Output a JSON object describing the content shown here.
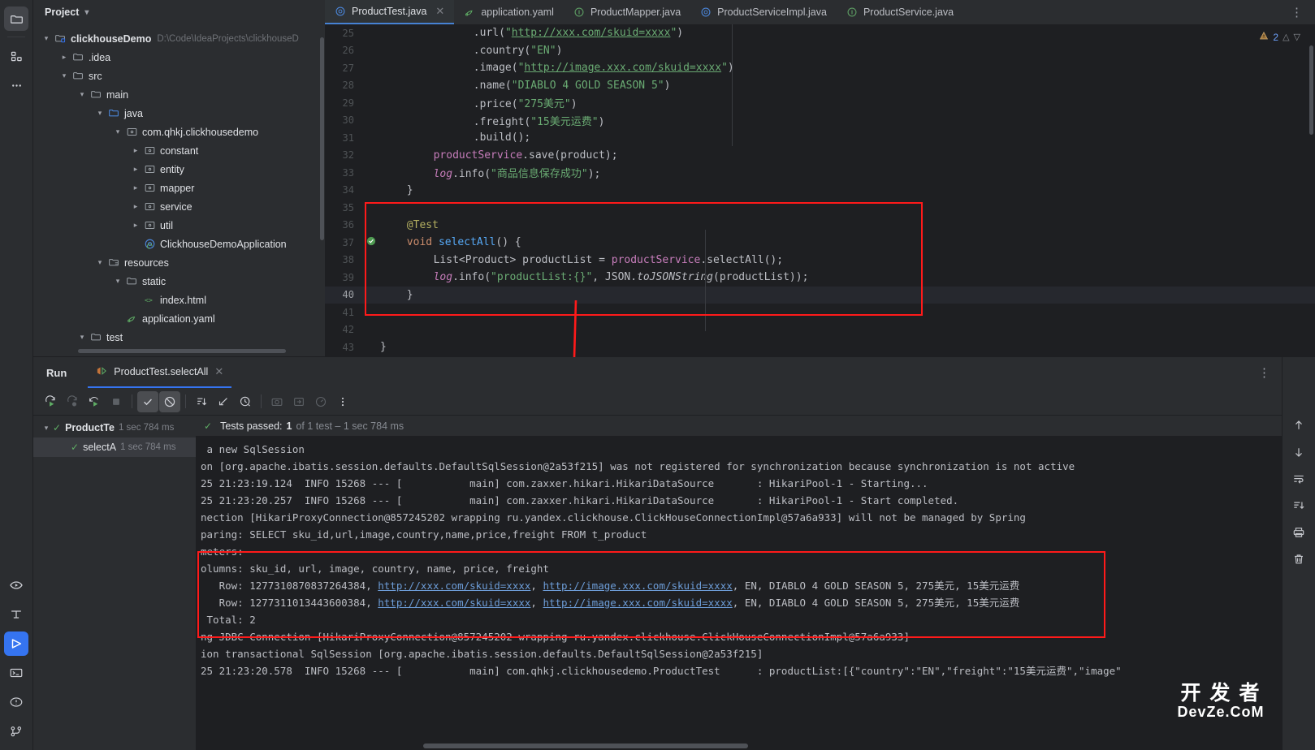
{
  "activity_bar": {
    "items": [
      {
        "name": "project-icon",
        "glyph": "folder"
      },
      {
        "name": "structure-icon",
        "glyph": "blocks"
      },
      {
        "name": "more-tools-icon",
        "glyph": "dots"
      }
    ],
    "bottom_items": [
      {
        "name": "run-anything-icon",
        "glyph": "eye-play"
      },
      {
        "name": "profiler-icon",
        "glyph": "t-shape"
      },
      {
        "name": "run-icon",
        "glyph": "play"
      },
      {
        "name": "terminal-icon",
        "glyph": "terminal"
      },
      {
        "name": "problems-icon",
        "glyph": "warning-circle"
      },
      {
        "name": "version-control-icon",
        "glyph": "branch"
      }
    ]
  },
  "project_panel": {
    "title": "Project",
    "tree": [
      {
        "depth": 0,
        "twisty": "down",
        "icon": "module",
        "label": "clickhouseDemo",
        "bold": true,
        "path": "D:\\Code\\IdeaProjects\\clickhouseD"
      },
      {
        "depth": 1,
        "twisty": "right",
        "icon": "folder",
        "label": ".idea"
      },
      {
        "depth": 1,
        "twisty": "down",
        "icon": "folder",
        "label": "src"
      },
      {
        "depth": 2,
        "twisty": "down",
        "icon": "folder",
        "label": "main"
      },
      {
        "depth": 3,
        "twisty": "down",
        "icon": "source",
        "label": "java"
      },
      {
        "depth": 4,
        "twisty": "down",
        "icon": "package",
        "label": "com.qhkj.clickhousedemo"
      },
      {
        "depth": 5,
        "twisty": "right",
        "icon": "package",
        "label": "constant"
      },
      {
        "depth": 5,
        "twisty": "right",
        "icon": "package",
        "label": "entity"
      },
      {
        "depth": 5,
        "twisty": "right",
        "icon": "package",
        "label": "mapper"
      },
      {
        "depth": 5,
        "twisty": "right",
        "icon": "package",
        "label": "service"
      },
      {
        "depth": 5,
        "twisty": "right",
        "icon": "package",
        "label": "util"
      },
      {
        "depth": 5,
        "twisty": "none",
        "icon": "springclass",
        "label": "ClickhouseDemoApplication"
      },
      {
        "depth": 3,
        "twisty": "down",
        "icon": "resources",
        "label": "resources"
      },
      {
        "depth": 4,
        "twisty": "down",
        "icon": "folder",
        "label": "static"
      },
      {
        "depth": 5,
        "twisty": "none",
        "icon": "html",
        "label": "index.html"
      },
      {
        "depth": 4,
        "twisty": "none",
        "icon": "yaml",
        "label": "application.yaml"
      },
      {
        "depth": 2,
        "twisty": "down",
        "icon": "folder",
        "label": "test"
      }
    ]
  },
  "editor": {
    "tabs": [
      {
        "label": "ProductTest.java",
        "icon": "class-icon",
        "active": true,
        "closable": true
      },
      {
        "label": "application.yaml",
        "icon": "yaml-icon",
        "active": false,
        "closable": false
      },
      {
        "label": "ProductMapper.java",
        "icon": "interface-icon",
        "active": false,
        "closable": false
      },
      {
        "label": "ProductServiceImpl.java",
        "icon": "class-icon",
        "active": false,
        "closable": false
      },
      {
        "label": "ProductService.java",
        "icon": "interface-icon",
        "active": false,
        "closable": false
      }
    ],
    "warnings": {
      "count": "2",
      "icon": "warning-icon"
    },
    "lines": [
      {
        "num": "25",
        "indent": 14,
        "runs": [
          {
            "t": ".url(",
            "c": "pln"
          },
          {
            "t": "\"",
            "c": "str"
          },
          {
            "t": "http://xxx.com/skuid=xxxx",
            "c": "link-str"
          },
          {
            "t": "\"",
            "c": "str"
          },
          {
            "t": ")",
            "c": "pln"
          }
        ]
      },
      {
        "num": "26",
        "indent": 14,
        "runs": [
          {
            "t": ".country(",
            "c": "pln"
          },
          {
            "t": "\"EN\"",
            "c": "str"
          },
          {
            "t": ")",
            "c": "pln"
          }
        ]
      },
      {
        "num": "27",
        "indent": 14,
        "runs": [
          {
            "t": ".image(",
            "c": "pln"
          },
          {
            "t": "\"",
            "c": "str"
          },
          {
            "t": "http://image.xxx.com/skuid=xxxx",
            "c": "link-str"
          },
          {
            "t": "\"",
            "c": "str"
          },
          {
            "t": ")",
            "c": "pln"
          }
        ]
      },
      {
        "num": "28",
        "indent": 14,
        "runs": [
          {
            "t": ".name(",
            "c": "pln"
          },
          {
            "t": "\"DIABLO 4 GOLD SEASON 5\"",
            "c": "str"
          },
          {
            "t": ")",
            "c": "pln"
          }
        ]
      },
      {
        "num": "29",
        "indent": 14,
        "runs": [
          {
            "t": ".price(",
            "c": "pln"
          },
          {
            "t": "\"275美元\"",
            "c": "str"
          },
          {
            "t": ")",
            "c": "pln"
          }
        ]
      },
      {
        "num": "30",
        "indent": 14,
        "runs": [
          {
            "t": ".freight(",
            "c": "pln"
          },
          {
            "t": "\"15美元运费\"",
            "c": "str"
          },
          {
            "t": ")",
            "c": "pln"
          }
        ]
      },
      {
        "num": "31",
        "indent": 14,
        "runs": [
          {
            "t": ".build();",
            "c": "pln"
          }
        ]
      },
      {
        "num": "32",
        "indent": 8,
        "runs": [
          {
            "t": "productService",
            "c": "fld"
          },
          {
            "t": ".save(product);",
            "c": "pln"
          }
        ]
      },
      {
        "num": "33",
        "indent": 8,
        "runs": [
          {
            "t": "log",
            "c": "fld ital"
          },
          {
            "t": ".info(",
            "c": "pln"
          },
          {
            "t": "\"商品信息保存成功\"",
            "c": "str"
          },
          {
            "t": ");",
            "c": "pln"
          }
        ]
      },
      {
        "num": "34",
        "indent": 4,
        "runs": [
          {
            "t": "}",
            "c": "pln"
          }
        ]
      },
      {
        "num": "35",
        "indent": 0,
        "runs": []
      },
      {
        "num": "36",
        "indent": 4,
        "runs": [
          {
            "t": "@Test",
            "c": "ann"
          }
        ]
      },
      {
        "num": "37",
        "indent": 4,
        "gutter": "test-pass-icon",
        "runs": [
          {
            "t": "void ",
            "c": "kw"
          },
          {
            "t": "selectAll",
            "c": "fn"
          },
          {
            "t": "() {",
            "c": "pln"
          }
        ]
      },
      {
        "num": "38",
        "indent": 8,
        "runs": [
          {
            "t": "List<Product> productList = ",
            "c": "pln"
          },
          {
            "t": "productService",
            "c": "fld"
          },
          {
            "t": ".selectAll();",
            "c": "pln"
          }
        ]
      },
      {
        "num": "39",
        "indent": 8,
        "runs": [
          {
            "t": "log",
            "c": "fld ital"
          },
          {
            "t": ".info(",
            "c": "pln"
          },
          {
            "t": "\"productList:{}\"",
            "c": "str"
          },
          {
            "t": ", JSON.",
            "c": "pln"
          },
          {
            "t": "toJSONString",
            "c": "pln ital"
          },
          {
            "t": "(productList));",
            "c": "pln"
          }
        ]
      },
      {
        "num": "40",
        "indent": 4,
        "current": true,
        "runs": [
          {
            "t": "}",
            "c": "pln"
          }
        ]
      },
      {
        "num": "41",
        "indent": 0,
        "runs": []
      },
      {
        "num": "42",
        "indent": 0,
        "runs": []
      },
      {
        "num": "43",
        "indent": 0,
        "runs": [
          {
            "t": "}",
            "c": "pln"
          }
        ]
      }
    ]
  },
  "run_panel": {
    "title": "Run",
    "tab_label": "ProductTest.selectAll",
    "toolbar": [
      {
        "name": "rerun-button",
        "glyph": "rerun",
        "state": "normal"
      },
      {
        "name": "rerun-failed-button",
        "glyph": "rerun-failed",
        "state": "dim"
      },
      {
        "name": "toggle-auto-test-button",
        "glyph": "auto-test",
        "state": "normal"
      },
      {
        "name": "stop-button",
        "glyph": "stop",
        "state": "dim"
      },
      {
        "name": "show-passed-button",
        "glyph": "check",
        "state": "on"
      },
      {
        "name": "show-ignored-button",
        "glyph": "ignored",
        "state": "on"
      },
      {
        "name": "sort-alphabetically-button",
        "glyph": "sort-az",
        "state": "normal"
      },
      {
        "name": "expand-collapse-button",
        "glyph": "collapse",
        "state": "normal"
      },
      {
        "name": "sort-by-duration-button",
        "glyph": "clock",
        "state": "normal"
      },
      {
        "name": "export-test-results-button",
        "glyph": "camera",
        "state": "dim"
      },
      {
        "name": "import-test-results-button",
        "glyph": "import",
        "state": "dim"
      },
      {
        "name": "test-statistics-button",
        "glyph": "gauge",
        "state": "dim"
      },
      {
        "name": "more-options-button",
        "glyph": "vdots",
        "state": "normal"
      }
    ],
    "test_tree": [
      {
        "label": "ProductTe",
        "time": "1 sec 784 ms",
        "twisty": "down",
        "selected": false,
        "indent": 0
      },
      {
        "label": "selectA",
        "time": "1 sec 784 ms",
        "twisty": "none",
        "selected": true,
        "indent": 1
      }
    ],
    "status": {
      "prefix": "Tests passed:",
      "count": "1",
      "suffix": "of 1 test – 1 sec 784 ms"
    },
    "console_lines": [
      {
        "segs": [
          {
            "t": " a new SqlSession"
          }
        ]
      },
      {
        "segs": [
          {
            "t": "on [org.apache.ibatis.session.defaults.DefaultSqlSession@2a53f215] was not registered for synchronization because synchronization is not active"
          }
        ]
      },
      {
        "segs": [
          {
            "t": "25 21:23:19.124  INFO 15268 --- [           main] com.zaxxer.hikari.HikariDataSource       : HikariPool-1 - Starting..."
          }
        ]
      },
      {
        "segs": [
          {
            "t": "25 21:23:20.257  INFO 15268 --- [           main] com.zaxxer.hikari.HikariDataSource       : HikariPool-1 - Start completed."
          }
        ]
      },
      {
        "segs": [
          {
            "t": "nection [HikariProxyConnection@857245202 wrapping ru.yandex.clickhouse.ClickHouseConnectionImpl@57a6a933] will not be managed by Spring"
          }
        ]
      },
      {
        "segs": [
          {
            "t": "paring: SELECT sku_id,url,image,country,name,price,freight FROM t_product"
          }
        ]
      },
      {
        "segs": [
          {
            "t": "meters:"
          }
        ]
      },
      {
        "segs": [
          {
            "t": "olumns: sku_id, url, image, country, name, price, freight"
          }
        ]
      },
      {
        "segs": [
          {
            "t": "   Row: 1277310870837264384, "
          },
          {
            "t": "http://xxx.com/skuid=xxxx",
            "link": true
          },
          {
            "t": ", "
          },
          {
            "t": "http://image.xxx.com/skuid=xxxx",
            "link": true
          },
          {
            "t": ", EN, DIABLO 4 GOLD SEASON 5, 275美元, 15美元运费"
          }
        ]
      },
      {
        "segs": [
          {
            "t": "   Row: 1277311013443600384, "
          },
          {
            "t": "http://xxx.com/skuid=xxxx",
            "link": true
          },
          {
            "t": ", "
          },
          {
            "t": "http://image.xxx.com/skuid=xxxx",
            "link": true
          },
          {
            "t": ", EN, DIABLO 4 GOLD SEASON 5, 275美元, 15美元运费"
          }
        ]
      },
      {
        "segs": [
          {
            "t": " Total: 2"
          }
        ]
      },
      {
        "segs": [
          {
            "t": "ng JDBC Connection [HikariProxyConnection@857245202 wrapping ru.yandex.clickhouse.ClickHouseConnectionImpl@57a6a933]"
          }
        ]
      },
      {
        "segs": [
          {
            "t": "ion transactional SqlSession [org.apache.ibatis.session.defaults.DefaultSqlSession@2a53f215]"
          }
        ]
      },
      {
        "segs": [
          {
            "t": "25 21:23:20.578  INFO 15268 --- [           main] com.qhkj.clickhousedemo.ProductTest      : productList:[{\"country\":\"EN\",\"freight\":\"15美元运费\",\"image\""
          }
        ]
      }
    ],
    "side_actions": [
      {
        "name": "scroll-up-icon",
        "glyph": "arrow-up"
      },
      {
        "name": "scroll-down-icon",
        "glyph": "arrow-down"
      },
      {
        "name": "soft-wrap-icon",
        "glyph": "wrap"
      },
      {
        "name": "scroll-to-end-icon",
        "glyph": "scroll-end"
      },
      {
        "name": "print-icon",
        "glyph": "print"
      },
      {
        "name": "clear-all-icon",
        "glyph": "trash"
      }
    ]
  },
  "watermark": {
    "line1": "开 发 者",
    "line2": "DevZe.CoM"
  },
  "colors": {
    "accent_blue": "#3574f0",
    "annotation_red": "#ff1a1a",
    "pass_green": "#5fad65",
    "string_green": "#6aab73",
    "keyword_orange": "#cf8e6d"
  }
}
